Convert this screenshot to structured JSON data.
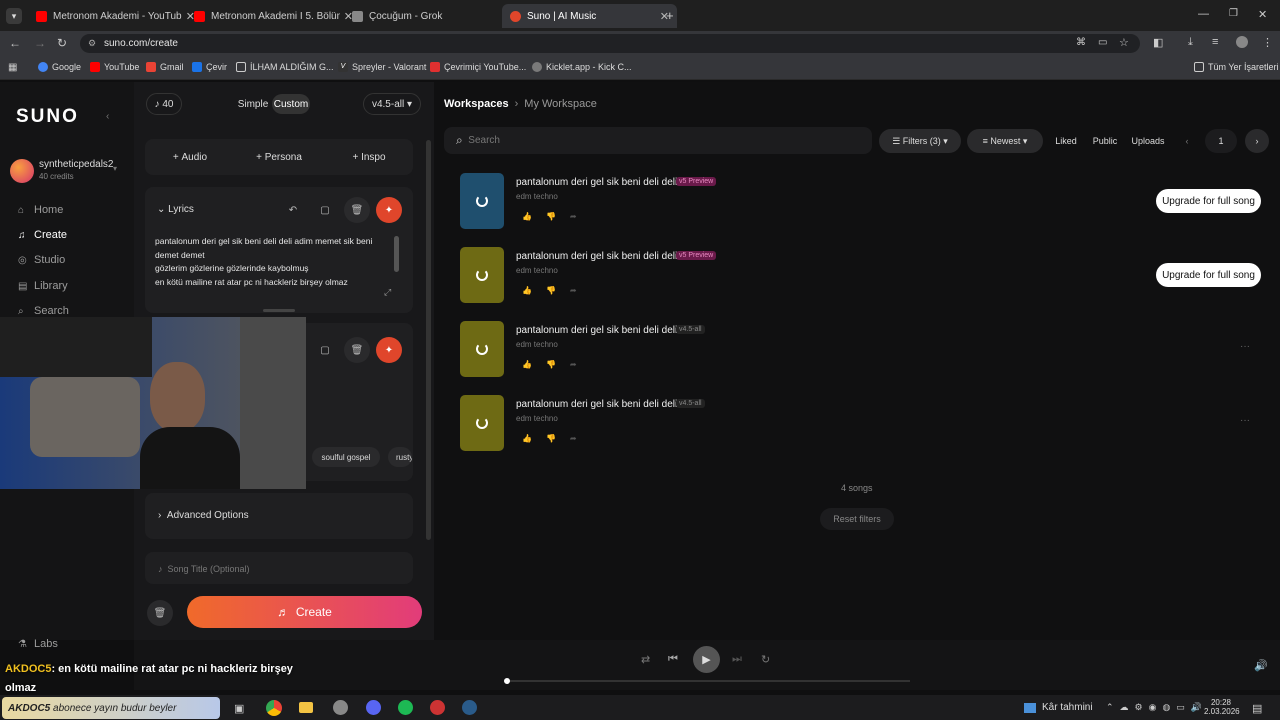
{
  "browser": {
    "tabs": [
      {
        "title": "Metronom Akademi - YouTube",
        "color": "#ff0000"
      },
      {
        "title": "Metronom Akademi I 5. Bölüm",
        "color": "#ff0000"
      },
      {
        "title": "Çocuğum - Grok",
        "color": "#888888"
      },
      {
        "title": "Suno | AI Music",
        "color": "#e0462b"
      }
    ],
    "url": "suno.com/create",
    "bookmarks": [
      "Google",
      "YouTube",
      "Gmail",
      "Çevir",
      "İLHAM ALDIĞIM G...",
      "Spreyler - Valorant",
      "Çevrimiçi YouTube...",
      "Kicklet.app - Kick C..."
    ],
    "all_bookmarks": "Tüm Yer İşaretleri"
  },
  "sidebar": {
    "logo": "SUNO",
    "user": {
      "name": "syntheticpedals2",
      "credits": "40 credits"
    },
    "items": [
      {
        "label": "Home",
        "icon": "home-icon"
      },
      {
        "label": "Create",
        "icon": "create-icon"
      },
      {
        "label": "Studio",
        "icon": "studio-icon"
      },
      {
        "label": "Library",
        "icon": "library-icon"
      },
      {
        "label": "Search",
        "icon": "search-icon"
      }
    ],
    "labs": "Labs"
  },
  "panel": {
    "credits_count": "40",
    "mode_simple": "Simple",
    "mode_custom": "Custom",
    "model": "v4.5-all",
    "add_audio": "Audio",
    "add_persona": "Persona",
    "add_inspo": "Inspo",
    "lyrics_label": "Lyrics",
    "lyrics_lines": [
      "pantalonum deri gel sik beni deli deli adim memet sik beni",
      "demet demet",
      "gözlerim gözlerine gözlerinde kaybolmuş",
      "en kötü mailine rat atar pc ni hackleriz birşey olmaz"
    ],
    "style_tags": [
      "soulful gospel",
      "rusty"
    ],
    "advanced": "Advanced Options",
    "song_title_placeholder": "Song Title (Optional)",
    "create": "Create"
  },
  "main": {
    "breadcrumb_root": "Workspaces",
    "breadcrumb_current": "My Workspace",
    "search_placeholder": "Search",
    "filters": "Filters (3)",
    "sort": "Newest",
    "liked": "Liked",
    "public": "Public",
    "uploads": "Uploads",
    "page": "1",
    "songs": [
      {
        "title": "pantalonum deri gel sik beni deli deli a",
        "badge": "v5 Preview",
        "genre": "edm techno",
        "art": "#1f4f6e",
        "upgrade": "Upgrade for full song"
      },
      {
        "title": "pantalonum deri gel sik beni deli deli a",
        "badge": "v5 Preview",
        "genre": "edm techno",
        "art": "#6e6a14",
        "upgrade": "Upgrade for full song"
      },
      {
        "title": "pantalonum deri gel sik beni deli deli a",
        "badge": "v4.5-all",
        "genre": "edm techno",
        "art": "#6e6a14",
        "upgrade": ""
      },
      {
        "title": "pantalonum deri gel sik beni deli deli a",
        "badge": "v4.5-all",
        "genre": "edm techno",
        "art": "#6e6a14",
        "upgrade": ""
      }
    ],
    "count": "4 songs",
    "reset": "Reset filters"
  },
  "overlay": {
    "chat_user": "AKDOC5",
    "chat_msg": ": en kötü mailine rat atar pc ni hackleriz birşey",
    "chat_msg2": "olmaz",
    "ticker_user": "AKDOC5",
    "ticker_msg": "abonece yayın budur beyler"
  },
  "taskbar": {
    "weather": "Kâr tahmini",
    "time": "20:28",
    "date": "2.03.2026"
  }
}
